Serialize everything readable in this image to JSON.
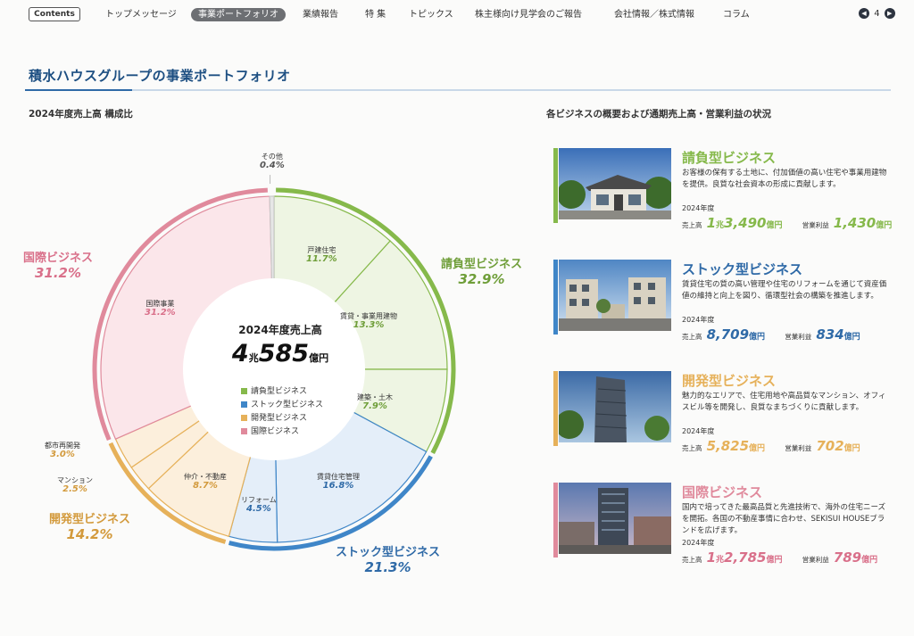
{
  "nav": {
    "contents_label": "Contents",
    "items": [
      "トップメッセージ",
      "事業ポートフォリオ",
      "業績報告",
      "特 集",
      "トピックス",
      "株主様向け見学会のご報告",
      "会社情報／株式情報",
      "コラム"
    ],
    "active_index": 1,
    "page_number": "4"
  },
  "title": "積水ハウスグループの事業ポートフォリオ",
  "left_subtitle": "2024年度売上高 構成比",
  "right_subtitle": "各ビジネスの概要および通期売上高・営業利益の状況",
  "colors": {
    "contract": "#86b94b",
    "stock": "#3f86c8",
    "development": "#e6b15a",
    "international": "#e08a9c",
    "other": "#c9c9c9"
  },
  "chart_data": {
    "type": "pie",
    "title": "2024年度売上高 構成比",
    "center": {
      "title": "2024年度売上高",
      "total_big": "4",
      "total_mid": "兆",
      "total_num": "585",
      "total_unit": "億円"
    },
    "segments": [
      {
        "name": "戸建住宅",
        "value": 11.7,
        "label": "11.7%",
        "group": "contract"
      },
      {
        "name": "賃貸・事業用建物",
        "value": 13.3,
        "label": "13.3%",
        "group": "contract"
      },
      {
        "name": "建築・土木",
        "value": 7.9,
        "label": "7.9%",
        "group": "contract"
      },
      {
        "name": "賃貸住宅管理",
        "value": 16.8,
        "label": "16.8%",
        "group": "stock"
      },
      {
        "name": "リフォーム",
        "value": 4.5,
        "label": "4.5%",
        "group": "stock"
      },
      {
        "name": "仲介・不動産",
        "value": 8.7,
        "label": "8.7%",
        "group": "development"
      },
      {
        "name": "マンション",
        "value": 2.5,
        "label": "2.5%",
        "group": "development"
      },
      {
        "name": "都市再開発",
        "value": 3.0,
        "label": "3.0%",
        "group": "development"
      },
      {
        "name": "国際事業",
        "value": 31.2,
        "label": "31.2%",
        "group": "international"
      },
      {
        "name": "その他",
        "value": 0.4,
        "label": "0.4%",
        "group": "other"
      }
    ],
    "groups": [
      {
        "key": "contract",
        "name": "請負型ビジネス",
        "value": 32.9,
        "label": "32.9%"
      },
      {
        "key": "stock",
        "name": "ストック型ビジネス",
        "value": 21.3,
        "label": "21.3%"
      },
      {
        "key": "development",
        "name": "開発型ビジネス",
        "value": 14.2,
        "label": "14.2%"
      },
      {
        "key": "international",
        "name": "国際ビジネス",
        "value": 31.2,
        "label": "31.2%"
      }
    ],
    "legend": [
      "請負型ビジネス",
      "ストック型ビジネス",
      "開発型ビジネス",
      "国際ビジネス"
    ]
  },
  "businesses": [
    {
      "name": "請負型ビジネス",
      "color": "#86b94b",
      "desc": "お客様の保有する土地に、付加価値の高い住宅や事業用建物を提供。良質な社会資本の形成に貢献します。",
      "year": "2024年度",
      "sales_label": "売上高",
      "sales_cho": "1",
      "sales_cho_unit": "兆",
      "sales_value": "3,490",
      "sales_unit": "億円",
      "profit_label": "営業利益",
      "profit_value": "1,430",
      "profit_unit": "億円"
    },
    {
      "name": "ストック型ビジネス",
      "color": "#3f86c8",
      "desc": "賃貸住宅の質の高い管理や住宅のリフォームを通じて資産価値の維持と向上を図り、循環型社会の構築を推進します。",
      "year": "2024年度",
      "sales_label": "売上高",
      "sales_cho": "",
      "sales_cho_unit": "",
      "sales_value": "8,709",
      "sales_unit": "億円",
      "profit_label": "営業利益",
      "profit_value": "834",
      "profit_unit": "億円"
    },
    {
      "name": "開発型ビジネス",
      "color": "#e6b15a",
      "desc": "魅力的なエリアで、住宅用地や高品質なマンション、オフィスビル等を開発し、良質なまちづくりに貢献します。",
      "year": "2024年度",
      "sales_label": "売上高",
      "sales_cho": "",
      "sales_cho_unit": "",
      "sales_value": "5,825",
      "sales_unit": "億円",
      "profit_label": "営業利益",
      "profit_value": "702",
      "profit_unit": "億円"
    },
    {
      "name": "国際ビジネス",
      "color": "#e08a9c",
      "desc": "国内で培ってきた最高品質と先進技術で、海外の住宅ニーズを開拓。各国の不動産事情に合わせ、SEKISUI HOUSEブランドを広げます。",
      "year": "2024年度",
      "sales_label": "売上高",
      "sales_cho": "1",
      "sales_cho_unit": "兆",
      "sales_value": "2,785",
      "sales_unit": "億円",
      "profit_label": "営業利益",
      "profit_value": "789",
      "profit_unit": "億円"
    }
  ]
}
